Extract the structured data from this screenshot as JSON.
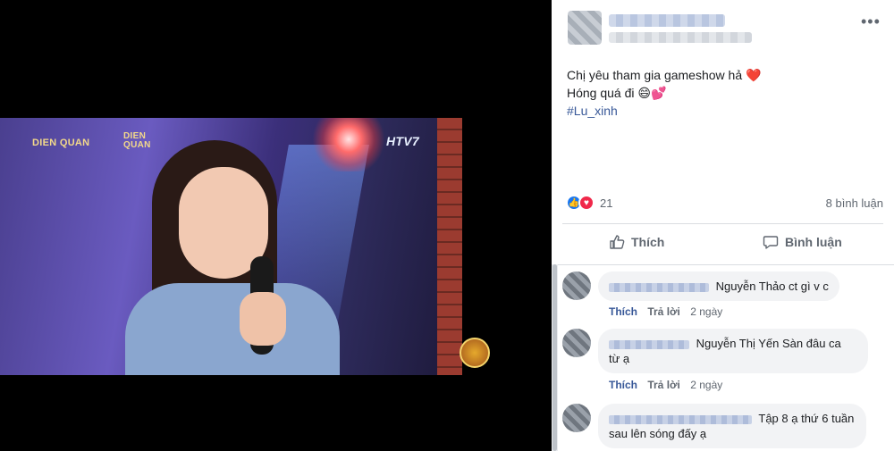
{
  "post": {
    "text_line_1": "Chị yêu tham gia gameshow hả",
    "text_line_2": "Hóng quá đi",
    "hashtag": "#Lu_xinh",
    "emoji_1": "❤️",
    "emoji_2": "😄💕"
  },
  "video": {
    "logo_1": "DIEN QUAN",
    "logo_2": "DIEN QUAN",
    "logo_3": "HTV7"
  },
  "reactions": {
    "count": "21",
    "comments": "8 bình luận"
  },
  "actions": {
    "like": "Thích",
    "comment": "Bình luận"
  },
  "comments": [
    {
      "text": "Nguyễn Thảo ct gì v c",
      "like": "Thích",
      "reply": "Trả lời",
      "time": "2 ngày"
    },
    {
      "text_line_1": "Nguyễn Thị Yến Sàn đâu ca",
      "text_line_2": "từ ạ",
      "like": "Thích",
      "reply": "Trả lời",
      "time": "2 ngày"
    },
    {
      "text_line_1": "Tập 8 ạ thứ 6 tuần",
      "text_line_2": "sau lên sóng đấy ạ"
    }
  ],
  "colors": {
    "link": "#385898",
    "reaction_like": "#1877f2",
    "reaction_love": "#f0284a"
  }
}
